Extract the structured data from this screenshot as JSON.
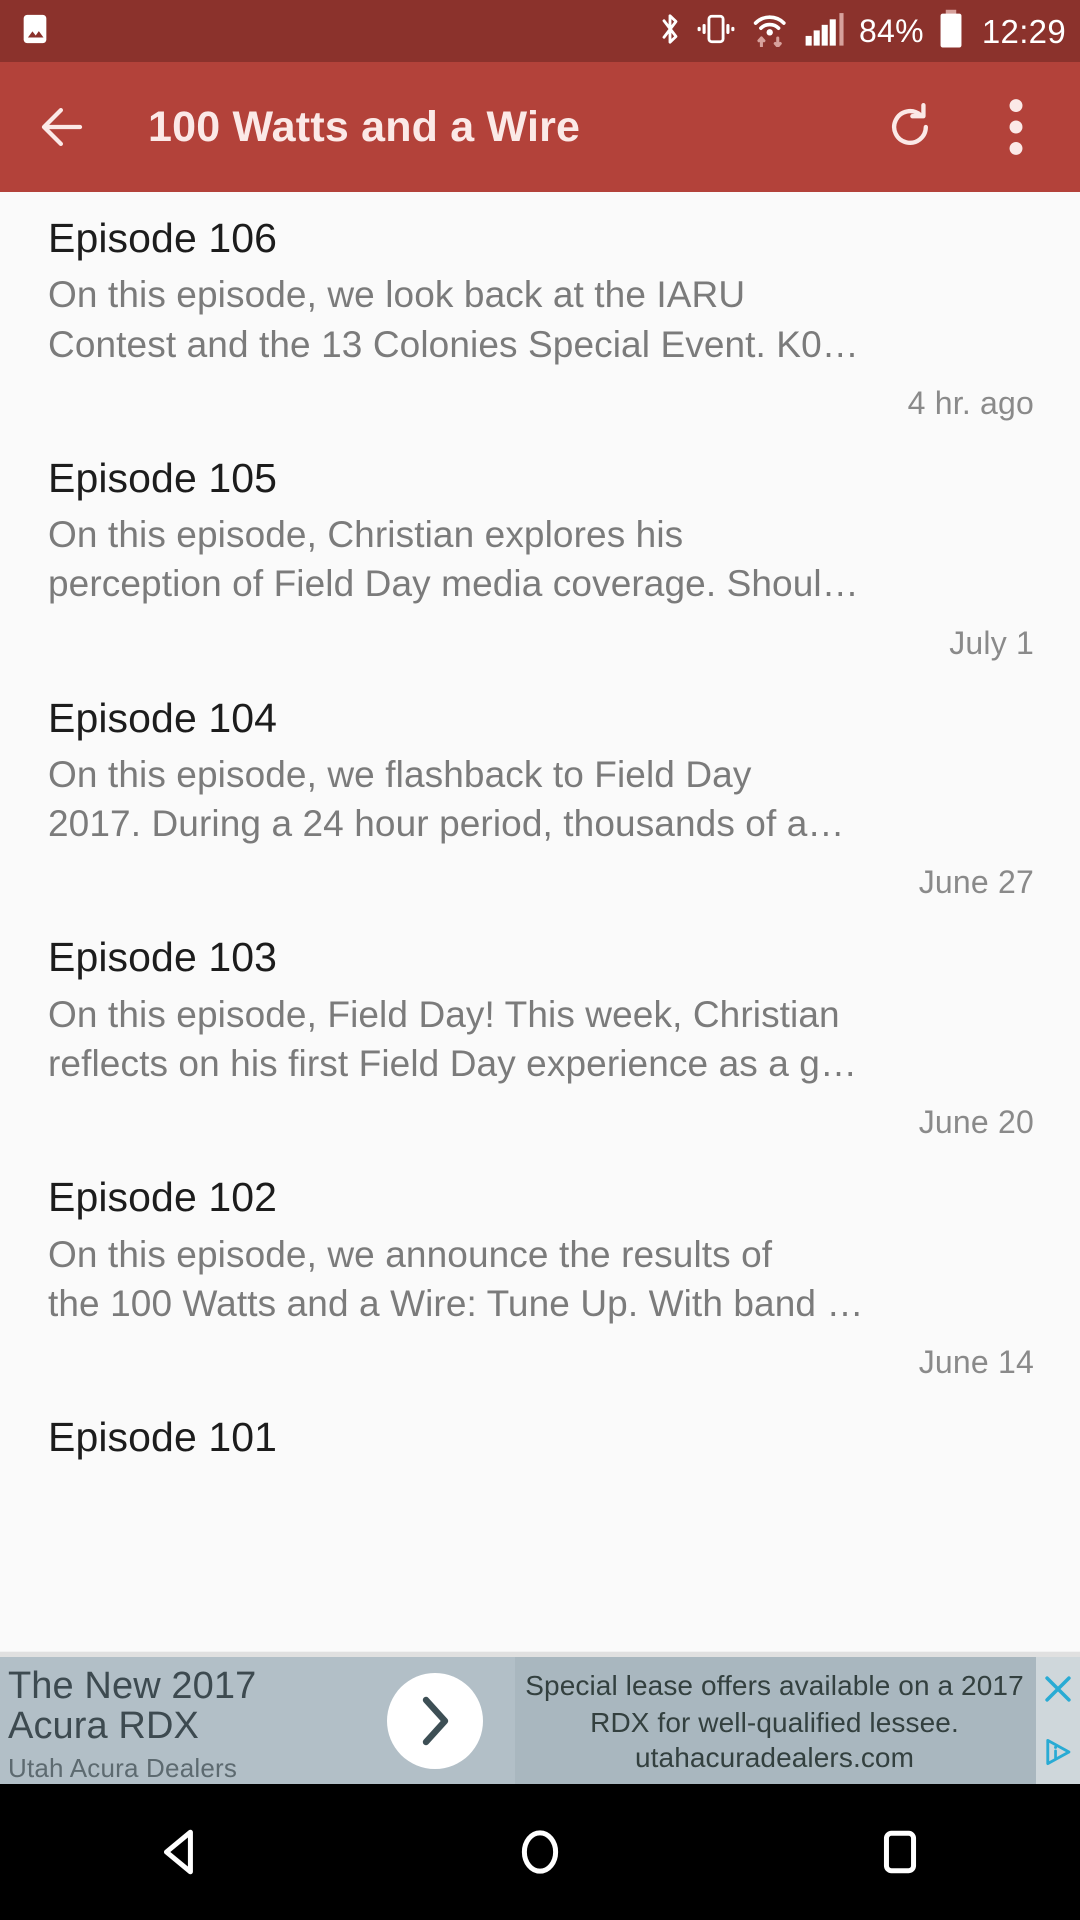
{
  "status_bar": {
    "image_icon": "image-icon",
    "bluetooth_icon": "bluetooth-icon",
    "vibrate_icon": "vibrate-icon",
    "wifi_icon": "wifi-icon",
    "signal_icon": "cellular-signal-icon",
    "battery_icon": "battery-icon",
    "battery_percent": "84%",
    "time": "12:29",
    "bg_color": "#8b322c"
  },
  "app_bar": {
    "back_icon": "back-arrow-icon",
    "title": "100 Watts and a Wire",
    "refresh_icon": "refresh-icon",
    "overflow_icon": "overflow-menu-icon",
    "bg_color": "#b3423a",
    "title_color": "#fbe9e7"
  },
  "episodes": [
    {
      "title": "Episode 106",
      "description": "On this episode, we look back at the IARU\nContest and the 13 Colonies Special Event. K0…",
      "date": "4 hr. ago"
    },
    {
      "title": "Episode 105",
      "description": "On this episode, Christian explores his\nperception of Field Day media coverage. Shoul…",
      "date": "July 1"
    },
    {
      "title": "Episode 104",
      "description": "On this episode, we flashback to Field Day\n2017. During a 24 hour period, thousands of a…",
      "date": "June 27"
    },
    {
      "title": "Episode 103",
      "description": "On this episode, Field Day! This week, Christian\nreflects on his first Field Day experience as a g…",
      "date": "June 20"
    },
    {
      "title": "Episode 102",
      "description": "On this episode, we announce the results of\nthe 100 Watts and a Wire: Tune Up. With band …",
      "date": "June 14"
    },
    {
      "title": "Episode 101",
      "description": "",
      "date": ""
    }
  ],
  "ad": {
    "headline": "The New 2017 Acura RDX",
    "advertiser": "Utah Acura Dealers",
    "body": "Special lease offers available on a 2017 RDX for well-qualified lessee.",
    "url": "utahacuradealers.com",
    "cta_icon": "chevron-right-icon",
    "close_icon": "close-icon",
    "adchoices_icon": "adchoices-icon",
    "bg_color": "#b2bfc7",
    "accent_color": "#29abd4"
  },
  "nav_bar": {
    "back_icon": "nav-back-triangle-icon",
    "home_icon": "nav-home-circle-icon",
    "recents_icon": "nav-recents-square-icon",
    "bg_color": "#000000"
  }
}
